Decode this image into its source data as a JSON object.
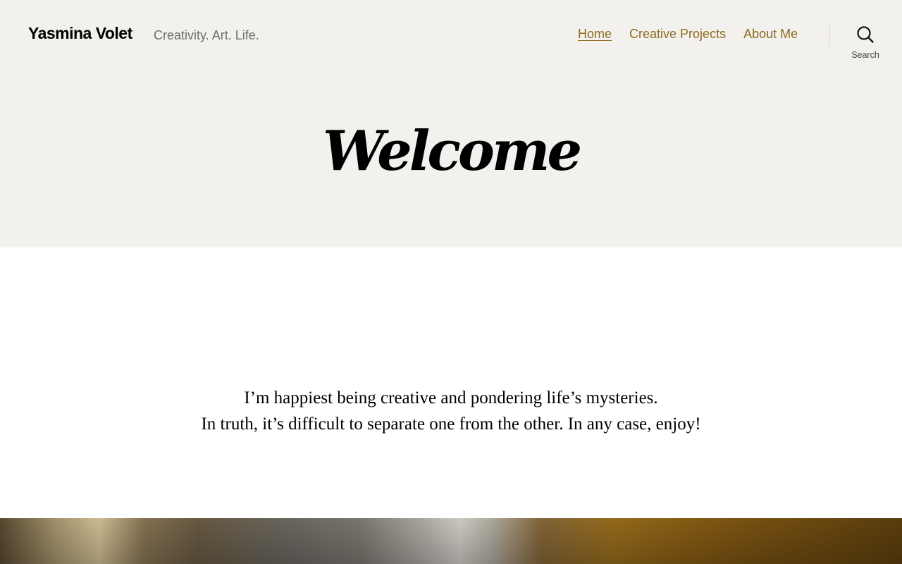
{
  "site": {
    "title": "Yasmina Volet",
    "description": "Creativity. Art. Life."
  },
  "nav": {
    "items": [
      {
        "label": "Home",
        "current": true
      },
      {
        "label": "Creative Projects",
        "current": false
      },
      {
        "label": "About Me",
        "current": false
      }
    ]
  },
  "search": {
    "label": "Search",
    "icon": "search-icon"
  },
  "page": {
    "title": "Welcome",
    "intro_line1": "I’m happiest being creative and pondering life’s mysteries.",
    "intro_line2": "In truth, it’s difficult to separate one from the other. In any case, enjoy!"
  },
  "colors": {
    "header_bg": "#f3f1ed",
    "accent": "#8f6a1e",
    "text": "#000000",
    "muted": "#6d6d6d"
  }
}
